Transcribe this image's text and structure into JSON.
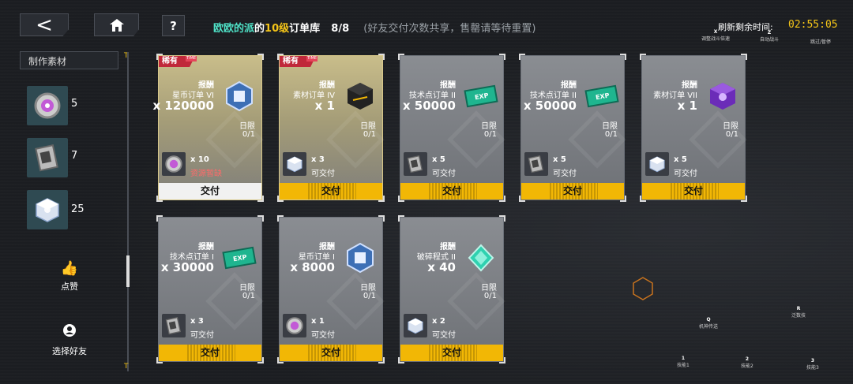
{
  "header": {
    "back_icon": "<",
    "help_label": "?",
    "title_owner": "欧欧的派",
    "title_of": "的",
    "title_level": "10级",
    "title_library": "订单库",
    "title_count": "8/8",
    "title_note": "(好友交付次数共享，售罄请等待重置)",
    "refresh_label": "刷新剩余时间:",
    "refresh_time": "02:55:05"
  },
  "hints": {
    "x_key": "X",
    "x_label": "调整战斗倍速",
    "z_key": "Z",
    "z_label": "自动战斗",
    "esc_label": "跳过/暂停",
    "q_key": "Q",
    "q_label": "机神传送",
    "r_key": "R",
    "r_label": "泛数技",
    "k1_key": "1",
    "k1_label": "技能1",
    "k2_key": "2",
    "k2_label": "技能2",
    "k3_key": "3",
    "k3_label": "技能3"
  },
  "sidebar": {
    "title": "制作素材",
    "rail_top": "T",
    "rail_bottom": "T",
    "materials": [
      {
        "name": "purple-orb",
        "count": "5"
      },
      {
        "name": "data-chip",
        "count": "7"
      },
      {
        "name": "crystal-cube",
        "count": "25"
      }
    ],
    "like_label": "点赞",
    "select_friend_label": "选择好友"
  },
  "common": {
    "reward_label": "报酬",
    "limit_label": "日限",
    "deliver_label": "交付",
    "rare_label": "稀有",
    "rare_sub": "TIME"
  },
  "orders": [
    {
      "order": "星币订单 VI",
      "amount": "x 120000",
      "progress": "0/1",
      "req_qty": "x 10",
      "req_status": "资源暂缺",
      "rare": true,
      "available": false
    },
    {
      "order": "素材订单 IV",
      "amount": "x 1",
      "progress": "0/1",
      "req_qty": "x 3",
      "req_status": "可交付",
      "rare": true,
      "available": true
    },
    {
      "order": "技术点订单 II",
      "amount": "x 50000",
      "progress": "0/1",
      "req_qty": "x 5",
      "req_status": "可交付",
      "rare": false,
      "available": true
    },
    {
      "order": "技术点订单 II",
      "amount": "x 50000",
      "progress": "0/1",
      "req_qty": "x 5",
      "req_status": "可交付",
      "rare": false,
      "available": true
    },
    {
      "order": "素材订单 VII",
      "amount": "x 1",
      "progress": "0/1",
      "req_qty": "x 5",
      "req_status": "可交付",
      "rare": false,
      "available": true
    },
    {
      "order": "技术点订单 I",
      "amount": "x 30000",
      "progress": "0/1",
      "req_qty": "x 3",
      "req_status": "可交付",
      "rare": false,
      "available": true
    },
    {
      "order": "星币订单 I",
      "amount": "x 8000",
      "progress": "0/1",
      "req_qty": "x 1",
      "req_status": "可交付",
      "rare": false,
      "available": true
    },
    {
      "order": "破碎程式 II",
      "amount": "x 40",
      "progress": "0/1",
      "req_qty": "x 2",
      "req_status": "可交付",
      "rare": false,
      "available": true
    }
  ],
  "colors": {
    "accent_yellow": "#f2b705",
    "accent_cyan": "#4fe3c8",
    "warn_red": "#ff6a6a",
    "rare_red": "#c0283a"
  }
}
